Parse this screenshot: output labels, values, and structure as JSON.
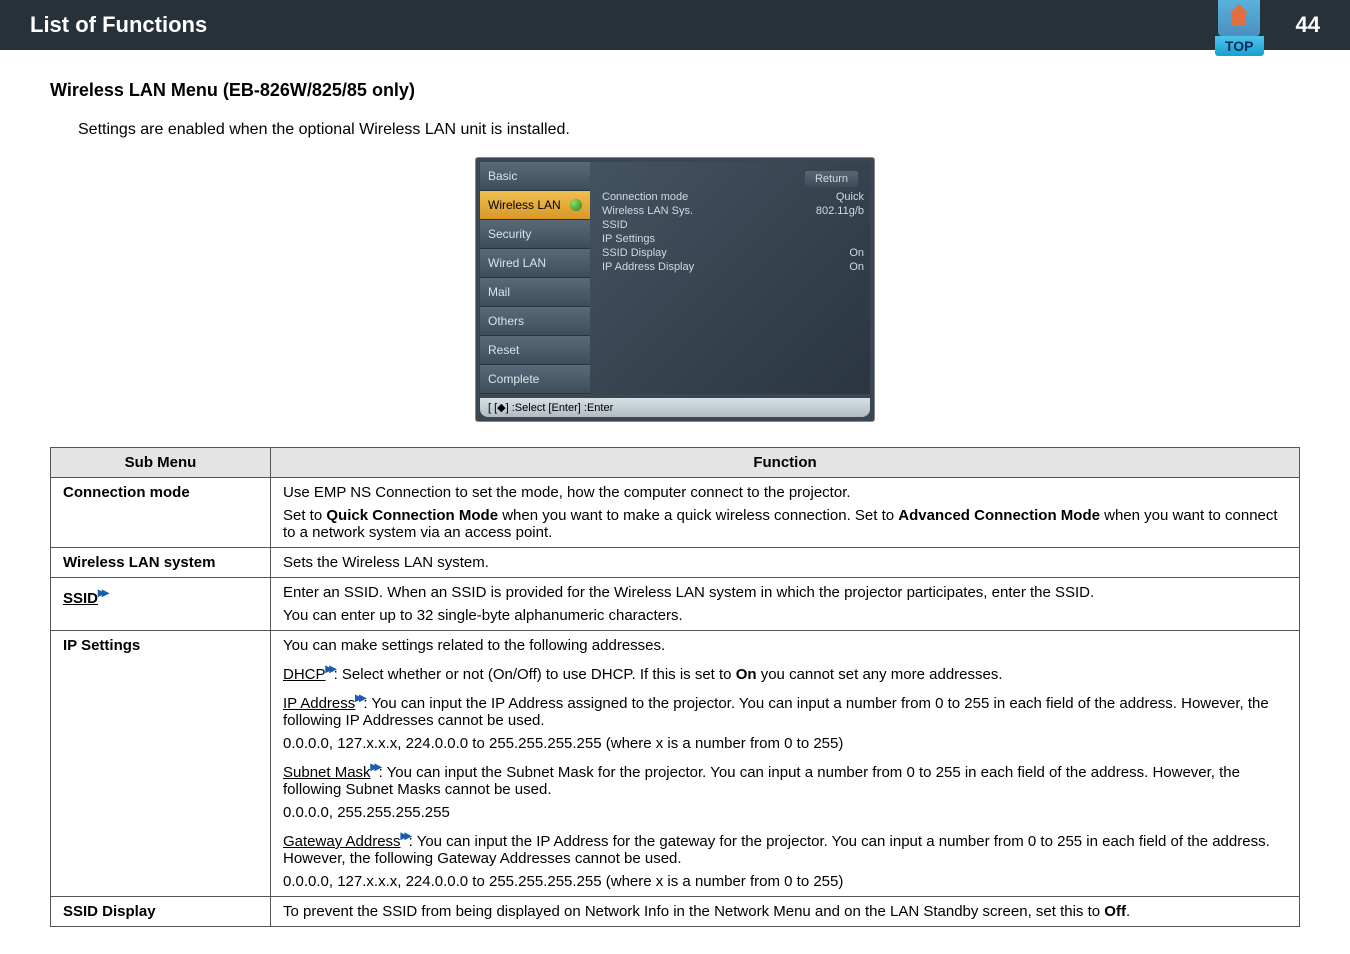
{
  "header": {
    "title": "List of Functions",
    "top_label": "TOP",
    "page_number": "44"
  },
  "section": {
    "title": "Wireless LAN Menu (EB-826W/825/85 only)",
    "intro": "Settings are enabled when the optional Wireless LAN unit is installed."
  },
  "menu_screenshot": {
    "left_items": [
      {
        "label": "Basic",
        "selected": false
      },
      {
        "label": "Wireless LAN",
        "selected": true
      },
      {
        "label": "Security",
        "selected": false
      },
      {
        "label": "Wired LAN",
        "selected": false
      },
      {
        "label": "Mail",
        "selected": false
      },
      {
        "label": "Others",
        "selected": false
      },
      {
        "label": "Reset",
        "selected": false
      },
      {
        "label": "Complete",
        "selected": false
      }
    ],
    "return_label": "Return",
    "settings": {
      "connection_mode_label": "Connection mode",
      "connection_mode_value": "Quick",
      "wlan_sys_label": "Wireless LAN Sys.",
      "wlan_sys_value": "802.11g/b",
      "ssid_label": "SSID",
      "ip_settings_label": "IP Settings",
      "ssid_display_label": "SSID Display",
      "ssid_display_value": "On",
      "ip_addr_display_label": "IP Address Display",
      "ip_addr_display_value": "On"
    },
    "footer": "[ [◆] :Select   [Enter] :Enter"
  },
  "table": {
    "col1": "Sub Menu",
    "col2": "Function",
    "rows": {
      "connection_mode": {
        "label": "Connection mode",
        "line1": "Use EMP NS Connection to set the mode, how the computer connect to the projector.",
        "line2_a": "Set to ",
        "line2_b": "Quick Connection Mode",
        "line2_c": " when you want to make a quick wireless connection. Set to ",
        "line2_d": "Advanced Connection Mode",
        "line2_e": " when you want to connect to a network system via an access point."
      },
      "wlan_system": {
        "label": "Wireless LAN system",
        "text": "Sets the Wireless LAN system."
      },
      "ssid": {
        "label": "SSID",
        "line1": "Enter an SSID. When an SSID is provided for the Wireless LAN system in which the projector participates, enter the SSID.",
        "line2": "You can enter up to 32 single-byte alphanumeric characters."
      },
      "ip_settings": {
        "label": "IP Settings",
        "line1": "You can make settings related to the following addresses.",
        "dhcp_term": "DHCP",
        "dhcp_text_a": ": Select whether or not (On/Off) to use DHCP. If this is set to ",
        "dhcp_text_b": "On",
        "dhcp_text_c": " you cannot set any more addresses.",
        "ip_addr_term": "IP Address",
        "ip_addr_text": ": You can input the IP Address assigned to the projector. You can input a number from 0 to 255 in each field of the address. However, the following IP Addresses cannot be used.",
        "ip_invalid": "0.0.0.0, 127.x.x.x, 224.0.0.0 to 255.255.255.255 (where x is a number from 0 to 255)",
        "subnet_term": "Subnet Mask",
        "subnet_text": ": You can input the Subnet Mask for the projector. You can input a number from 0 to 255 in each field of the address. However, the following Subnet Masks cannot be used.",
        "subnet_invalid": "0.0.0.0, 255.255.255.255",
        "gateway_term": "Gateway Address",
        "gateway_text": ": You can input the IP Address for the gateway for the projector. You can input a number from 0 to 255 in each field of the address. However, the following Gateway Addresses cannot be used.",
        "gateway_invalid": "0.0.0.0, 127.x.x.x, 224.0.0.0 to 255.255.255.255 (where x is a number from 0 to 255)"
      },
      "ssid_display": {
        "label": "SSID Display",
        "text_a": "To prevent the SSID from being displayed on Network Info in the Network Menu and on the LAN Standby screen, set this to ",
        "text_b": "Off",
        "text_c": "."
      }
    }
  }
}
